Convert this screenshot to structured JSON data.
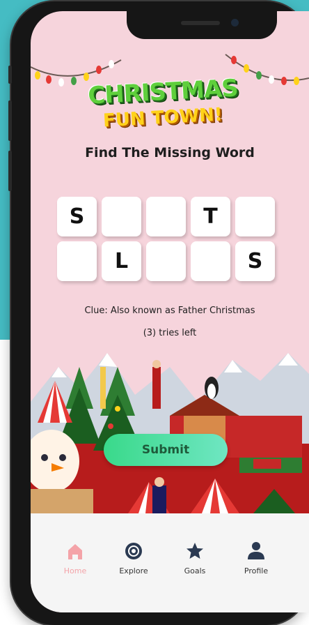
{
  "app": {
    "logo_line1": "CHRISTMAS",
    "logo_line2": "FUN TOWN!",
    "title": "Find The Missing Word"
  },
  "puzzle": {
    "tiles": [
      "S",
      "",
      "",
      "T",
      "",
      "",
      "L",
      "",
      "",
      "S"
    ],
    "clue": "Clue: Also known as Father Christmas",
    "tries": "(3) tries left"
  },
  "actions": {
    "submit_label": "Submit"
  },
  "nav": {
    "items": [
      {
        "label": "Home",
        "icon": "home-icon",
        "active": true
      },
      {
        "label": "Explore",
        "icon": "compass-icon",
        "active": false
      },
      {
        "label": "Goals",
        "icon": "star-icon",
        "active": false
      },
      {
        "label": "Profile",
        "icon": "user-icon",
        "active": false
      }
    ]
  },
  "colors": {
    "screen_bg": "#f6d4dc",
    "submit_start": "#39d98a",
    "submit_end": "#6fe6c2",
    "nav_active": "#f4a3a8",
    "backdrop": "#45bcc3"
  }
}
